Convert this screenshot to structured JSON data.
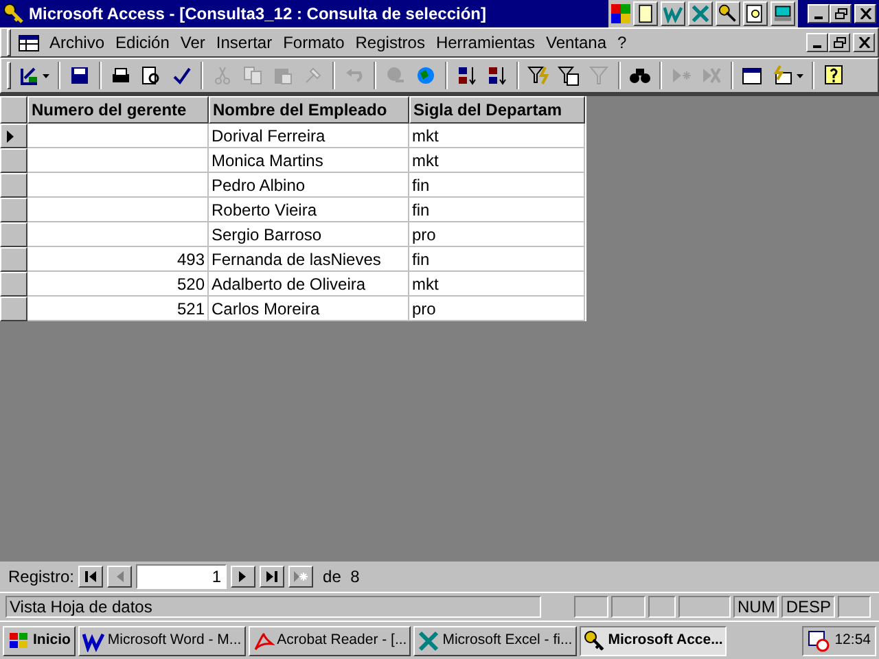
{
  "window": {
    "title": "Microsoft Access - [Consulta3_12 : Consulta de selección]"
  },
  "menu": [
    "Archivo",
    "Edición",
    "Ver",
    "Insertar",
    "Formato",
    "Registros",
    "Herramientas",
    "Ventana",
    "?"
  ],
  "toolbar": [
    {
      "kind": "design",
      "disabled": false
    },
    {
      "kind": "separator"
    },
    {
      "kind": "save",
      "disabled": false
    },
    {
      "kind": "separator"
    },
    {
      "kind": "print",
      "disabled": false
    },
    {
      "kind": "preview",
      "disabled": false
    },
    {
      "kind": "spell",
      "disabled": false
    },
    {
      "kind": "separator"
    },
    {
      "kind": "cut",
      "disabled": true
    },
    {
      "kind": "copy",
      "disabled": true
    },
    {
      "kind": "paste",
      "disabled": true
    },
    {
      "kind": "painter",
      "disabled": true
    },
    {
      "kind": "separator"
    },
    {
      "kind": "undo",
      "disabled": true
    },
    {
      "kind": "separator"
    },
    {
      "kind": "link",
      "disabled": true
    },
    {
      "kind": "web",
      "disabled": false
    },
    {
      "kind": "separator"
    },
    {
      "kind": "sortasc",
      "disabled": false
    },
    {
      "kind": "sortdesc",
      "disabled": false
    },
    {
      "kind": "separator"
    },
    {
      "kind": "filtersel",
      "disabled": false
    },
    {
      "kind": "filterform",
      "disabled": false
    },
    {
      "kind": "filter",
      "disabled": true
    },
    {
      "kind": "separator"
    },
    {
      "kind": "find",
      "disabled": false
    },
    {
      "kind": "separator"
    },
    {
      "kind": "newrec",
      "disabled": true
    },
    {
      "kind": "delrec",
      "disabled": true
    },
    {
      "kind": "separator"
    },
    {
      "kind": "dbwindow",
      "disabled": false
    },
    {
      "kind": "newobject",
      "disabled": false
    },
    {
      "kind": "separator"
    },
    {
      "kind": "help",
      "disabled": false
    }
  ],
  "table": {
    "columns": [
      "Numero del gerente",
      "Nombre del Empleado",
      "Sigla del Departam"
    ],
    "rows": [
      {
        "current": true,
        "cells": [
          "",
          "Dorival Ferreira",
          "mkt"
        ]
      },
      {
        "current": false,
        "cells": [
          "",
          "Monica Martins",
          "mkt"
        ]
      },
      {
        "current": false,
        "cells": [
          "",
          "Pedro Albino",
          "fin"
        ]
      },
      {
        "current": false,
        "cells": [
          "",
          "Roberto Vieira",
          "fin"
        ]
      },
      {
        "current": false,
        "cells": [
          "",
          "Sergio Barroso",
          "pro"
        ]
      },
      {
        "current": false,
        "cells": [
          "493",
          "Fernanda de lasNieves",
          "fin"
        ]
      },
      {
        "current": false,
        "cells": [
          "520",
          "Adalberto de Oliveira",
          "mkt"
        ]
      },
      {
        "current": false,
        "cells": [
          "521",
          "Carlos Moreira",
          "pro"
        ]
      }
    ]
  },
  "navigator": {
    "label": "Registro:",
    "value": "1",
    "of": "de",
    "total": "8"
  },
  "status_bar": {
    "text": "Vista Hoja de datos",
    "indicators": [
      "NUM",
      "DESP"
    ]
  },
  "taskbar": {
    "start": "Inicio",
    "tasks": [
      {
        "kind": "word",
        "label": "Microsoft Word - M...",
        "selected": false
      },
      {
        "kind": "acrobat",
        "label": "Acrobat Reader - [...",
        "selected": false
      },
      {
        "kind": "excel",
        "label": "Microsoft Excel - fi...",
        "selected": false
      },
      {
        "kind": "access",
        "label": "Microsoft Acce...",
        "selected": true
      }
    ],
    "clock": "12:54"
  }
}
